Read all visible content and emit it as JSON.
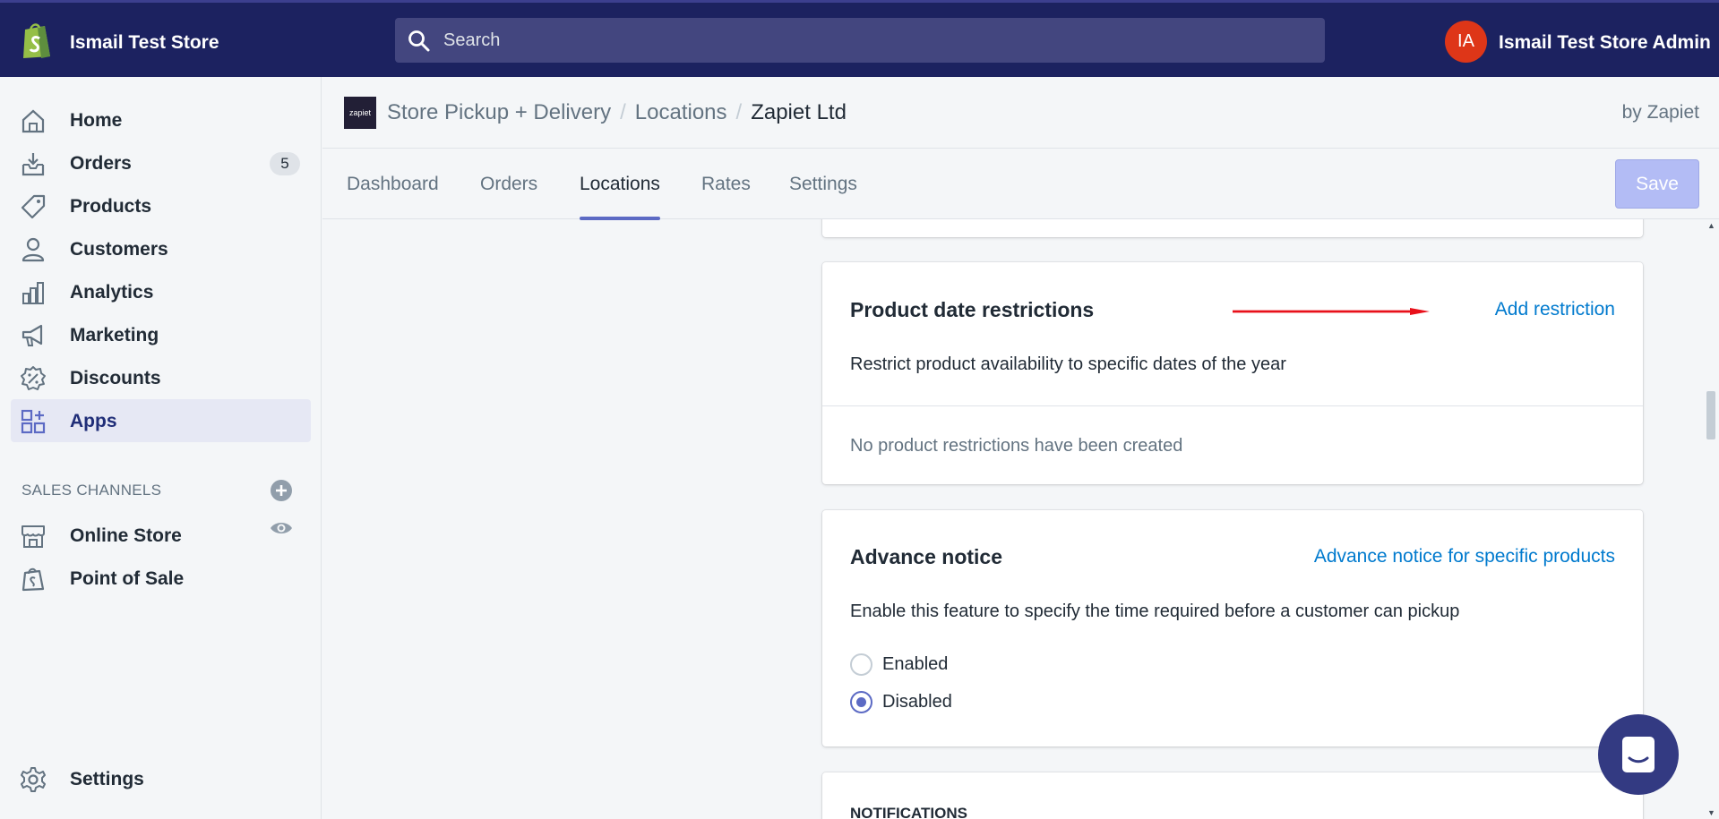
{
  "topbar": {
    "store_name": "Ismail Test Store",
    "search_placeholder": "Search",
    "avatar_initials": "IA",
    "admin_name": "Ismail Test Store Admin"
  },
  "sidebar": {
    "items": [
      {
        "label": "Home",
        "icon": "home-icon"
      },
      {
        "label": "Orders",
        "icon": "orders-icon",
        "badge": "5"
      },
      {
        "label": "Products",
        "icon": "tag-icon"
      },
      {
        "label": "Customers",
        "icon": "person-icon"
      },
      {
        "label": "Analytics",
        "icon": "bar-chart-icon"
      },
      {
        "label": "Marketing",
        "icon": "megaphone-icon"
      },
      {
        "label": "Discounts",
        "icon": "discount-icon"
      },
      {
        "label": "Apps",
        "icon": "apps-icon",
        "active": true
      }
    ],
    "sales_channels_label": "SALES CHANNELS",
    "channels": [
      {
        "label": "Online Store",
        "icon": "store-icon"
      },
      {
        "label": "Point of Sale",
        "icon": "pos-bag-icon"
      }
    ],
    "settings_label": "Settings"
  },
  "app_header": {
    "logo_text": "zapiet",
    "breadcrumb": [
      "Store Pickup + Delivery",
      "Locations",
      "Zapiet Ltd"
    ],
    "by_line": "by Zapiet"
  },
  "tabs": [
    {
      "label": "Dashboard"
    },
    {
      "label": "Orders"
    },
    {
      "label": "Locations",
      "active": true
    },
    {
      "label": "Rates"
    },
    {
      "label": "Settings"
    }
  ],
  "save_label": "Save",
  "product_date_card": {
    "title": "Product date restrictions",
    "link": "Add restriction",
    "description": "Restrict product availability to specific dates of the year",
    "empty_text": "No product restrictions have been created"
  },
  "advance_notice_card": {
    "title": "Advance notice",
    "link": "Advance notice for specific products",
    "description": "Enable this feature to specify the time required before a customer can pickup",
    "options": [
      {
        "label": "Enabled",
        "checked": false
      },
      {
        "label": "Disabled",
        "checked": true
      }
    ]
  },
  "notifications_card": {
    "title": "NOTIFICATIONS"
  },
  "colors": {
    "topbar": "#1c2260",
    "accent": "#5c6ac4",
    "link": "#007ace",
    "annotation_arrow": "#e8101a"
  }
}
